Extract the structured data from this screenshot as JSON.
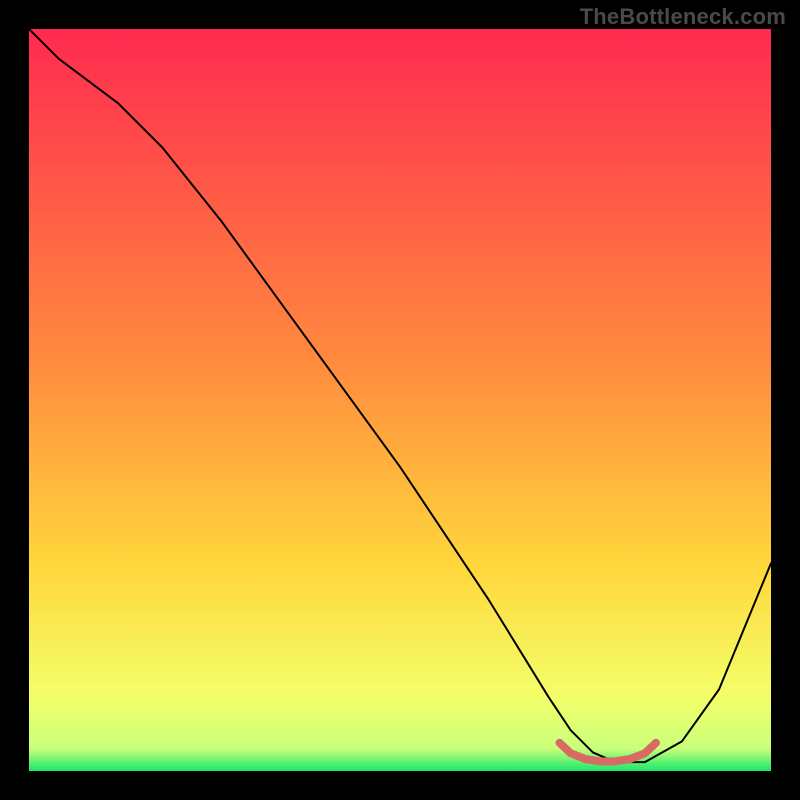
{
  "watermark": "TheBottleneck.com",
  "chart_data": {
    "type": "line",
    "title": "",
    "xlabel": "",
    "ylabel": "",
    "xlim": [
      0,
      100
    ],
    "ylim": [
      0,
      100
    ],
    "grid": false,
    "legend": false,
    "background_gradient": {
      "top": "#ff2a4f",
      "mid": "#ffd63b",
      "bottom": "#17e86a"
    },
    "series": [
      {
        "name": "curve",
        "color": "#000000",
        "stroke_width": 2,
        "x": [
          0,
          4,
          8,
          12,
          18,
          26,
          34,
          42,
          50,
          58,
          62,
          66,
          70,
          73,
          76,
          79,
          83,
          88,
          93,
          100
        ],
        "y": [
          100,
          96,
          93,
          90,
          84,
          74,
          63,
          52,
          41,
          29,
          23,
          16.5,
          10,
          5.5,
          2.5,
          1.2,
          1.2,
          4,
          11,
          28
        ]
      },
      {
        "name": "highlight-band",
        "color": "#d86a63",
        "stroke_width": 8,
        "x": [
          71.5,
          73,
          75,
          77,
          79,
          81,
          83,
          84.5
        ],
        "y": [
          3.8,
          2.4,
          1.6,
          1.3,
          1.3,
          1.6,
          2.4,
          3.8
        ]
      }
    ]
  }
}
